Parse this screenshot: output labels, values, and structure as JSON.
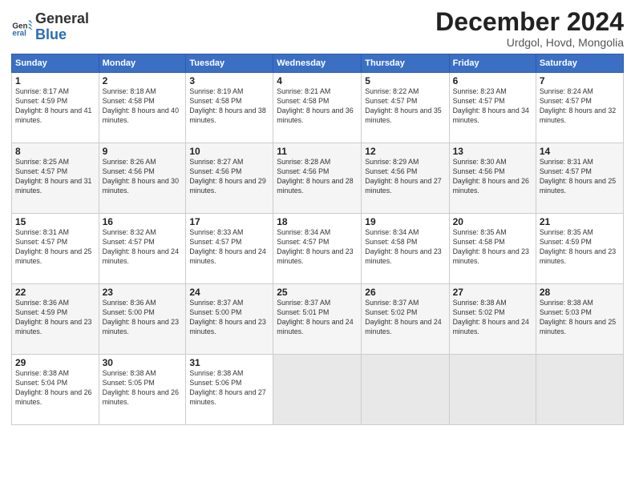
{
  "logo": {
    "line1": "General",
    "line2": "Blue"
  },
  "title": "December 2024",
  "subtitle": "Urdgol, Hovd, Mongolia",
  "days_header": [
    "Sunday",
    "Monday",
    "Tuesday",
    "Wednesday",
    "Thursday",
    "Friday",
    "Saturday"
  ],
  "weeks": [
    [
      {
        "day": "1",
        "sunrise": "8:17 AM",
        "sunset": "4:59 PM",
        "daylight": "8 hours and 41 minutes."
      },
      {
        "day": "2",
        "sunrise": "8:18 AM",
        "sunset": "4:58 PM",
        "daylight": "8 hours and 40 minutes."
      },
      {
        "day": "3",
        "sunrise": "8:19 AM",
        "sunset": "4:58 PM",
        "daylight": "8 hours and 38 minutes."
      },
      {
        "day": "4",
        "sunrise": "8:21 AM",
        "sunset": "4:58 PM",
        "daylight": "8 hours and 36 minutes."
      },
      {
        "day": "5",
        "sunrise": "8:22 AM",
        "sunset": "4:57 PM",
        "daylight": "8 hours and 35 minutes."
      },
      {
        "day": "6",
        "sunrise": "8:23 AM",
        "sunset": "4:57 PM",
        "daylight": "8 hours and 34 minutes."
      },
      {
        "day": "7",
        "sunrise": "8:24 AM",
        "sunset": "4:57 PM",
        "daylight": "8 hours and 32 minutes."
      }
    ],
    [
      {
        "day": "8",
        "sunrise": "8:25 AM",
        "sunset": "4:57 PM",
        "daylight": "8 hours and 31 minutes."
      },
      {
        "day": "9",
        "sunrise": "8:26 AM",
        "sunset": "4:56 PM",
        "daylight": "8 hours and 30 minutes."
      },
      {
        "day": "10",
        "sunrise": "8:27 AM",
        "sunset": "4:56 PM",
        "daylight": "8 hours and 29 minutes."
      },
      {
        "day": "11",
        "sunrise": "8:28 AM",
        "sunset": "4:56 PM",
        "daylight": "8 hours and 28 minutes."
      },
      {
        "day": "12",
        "sunrise": "8:29 AM",
        "sunset": "4:56 PM",
        "daylight": "8 hours and 27 minutes."
      },
      {
        "day": "13",
        "sunrise": "8:30 AM",
        "sunset": "4:56 PM",
        "daylight": "8 hours and 26 minutes."
      },
      {
        "day": "14",
        "sunrise": "8:31 AM",
        "sunset": "4:57 PM",
        "daylight": "8 hours and 25 minutes."
      }
    ],
    [
      {
        "day": "15",
        "sunrise": "8:31 AM",
        "sunset": "4:57 PM",
        "daylight": "8 hours and 25 minutes."
      },
      {
        "day": "16",
        "sunrise": "8:32 AM",
        "sunset": "4:57 PM",
        "daylight": "8 hours and 24 minutes."
      },
      {
        "day": "17",
        "sunrise": "8:33 AM",
        "sunset": "4:57 PM",
        "daylight": "8 hours and 24 minutes."
      },
      {
        "day": "18",
        "sunrise": "8:34 AM",
        "sunset": "4:57 PM",
        "daylight": "8 hours and 23 minutes."
      },
      {
        "day": "19",
        "sunrise": "8:34 AM",
        "sunset": "4:58 PM",
        "daylight": "8 hours and 23 minutes."
      },
      {
        "day": "20",
        "sunrise": "8:35 AM",
        "sunset": "4:58 PM",
        "daylight": "8 hours and 23 minutes."
      },
      {
        "day": "21",
        "sunrise": "8:35 AM",
        "sunset": "4:59 PM",
        "daylight": "8 hours and 23 minutes."
      }
    ],
    [
      {
        "day": "22",
        "sunrise": "8:36 AM",
        "sunset": "4:59 PM",
        "daylight": "8 hours and 23 minutes."
      },
      {
        "day": "23",
        "sunrise": "8:36 AM",
        "sunset": "5:00 PM",
        "daylight": "8 hours and 23 minutes."
      },
      {
        "day": "24",
        "sunrise": "8:37 AM",
        "sunset": "5:00 PM",
        "daylight": "8 hours and 23 minutes."
      },
      {
        "day": "25",
        "sunrise": "8:37 AM",
        "sunset": "5:01 PM",
        "daylight": "8 hours and 24 minutes."
      },
      {
        "day": "26",
        "sunrise": "8:37 AM",
        "sunset": "5:02 PM",
        "daylight": "8 hours and 24 minutes."
      },
      {
        "day": "27",
        "sunrise": "8:38 AM",
        "sunset": "5:02 PM",
        "daylight": "8 hours and 24 minutes."
      },
      {
        "day": "28",
        "sunrise": "8:38 AM",
        "sunset": "5:03 PM",
        "daylight": "8 hours and 25 minutes."
      }
    ],
    [
      {
        "day": "29",
        "sunrise": "8:38 AM",
        "sunset": "5:04 PM",
        "daylight": "8 hours and 26 minutes."
      },
      {
        "day": "30",
        "sunrise": "8:38 AM",
        "sunset": "5:05 PM",
        "daylight": "8 hours and 26 minutes."
      },
      {
        "day": "31",
        "sunrise": "8:38 AM",
        "sunset": "5:06 PM",
        "daylight": "8 hours and 27 minutes."
      },
      null,
      null,
      null,
      null
    ]
  ]
}
